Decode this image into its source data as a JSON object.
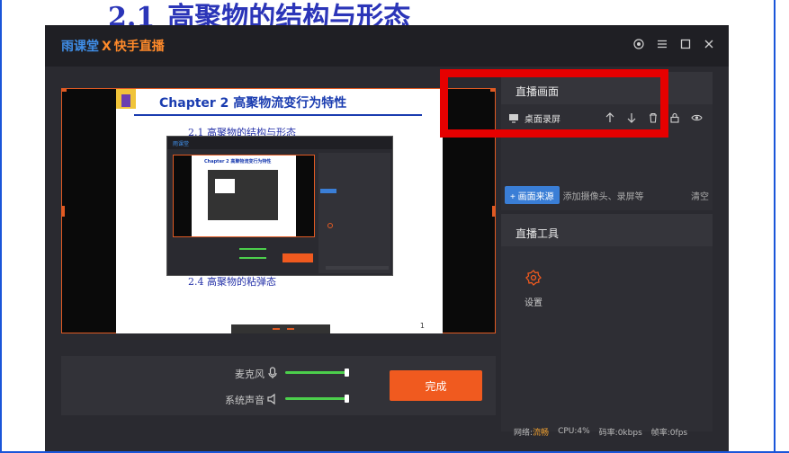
{
  "background_slide": {
    "section_number": "2.1",
    "section_title": "高聚物的结构与形态"
  },
  "app": {
    "brand_left": "雨课堂",
    "brand_sep": "X",
    "brand_right": "快手直播"
  },
  "preview": {
    "slide_title": "Chapter 2  高聚物流变行为特性",
    "line_1": "2.1  高聚物的结构与形态",
    "line_4": "2.4  高聚物的粘弹态",
    "page_number": "1",
    "nested_title": "Chapter 2  高聚物流变行为特性"
  },
  "audio": {
    "mic_label": "麦克风",
    "mic_level": 0.95,
    "system_label": "系统声音",
    "system_level": 0.95,
    "done_label": "完成"
  },
  "live_panel": {
    "header": "直播画面",
    "source_label": "桌面录屏",
    "add_button": "+ 画面来源",
    "add_hint": "添加摄像头、录屏等",
    "clear_label": "清空"
  },
  "tools_panel": {
    "header": "直播工具",
    "settings_label": "设置"
  },
  "status": {
    "network_label": "网络:",
    "network_value": "流畅",
    "cpu": "CPU:4%",
    "bitrate": "码率:0kbps",
    "framerate": "帧率:0fps"
  },
  "colors": {
    "accent": "#f05a1f",
    "blue": "#3a7ed6",
    "highlight_box": "#e60000",
    "slider": "#4ccf4c"
  }
}
